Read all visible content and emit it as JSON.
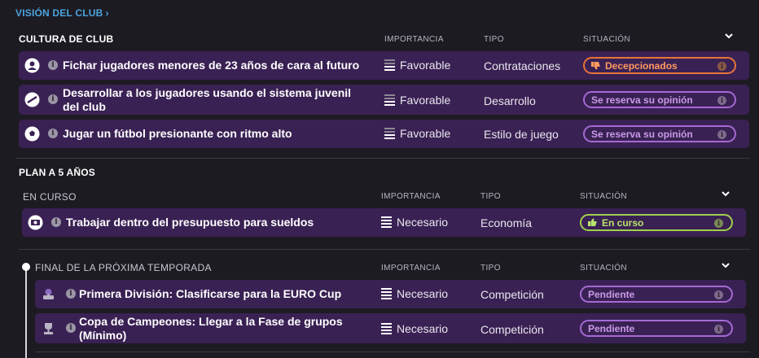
{
  "header": {
    "link_label": "VISIÓN DEL CLUB",
    "link_chevron": "›"
  },
  "columns": {
    "importance": "IMPORTANCIA",
    "type": "TIPO",
    "status": "SITUACIÓN"
  },
  "collapse_icon": "chevron-down-icon",
  "culture": {
    "title": "CULTURA DE CLUB",
    "rows": [
      {
        "icon": "user-icon",
        "title": "Fichar jugadores menores de 23 años de cara al futuro",
        "importance": "Favorable",
        "type": "Contrataciones",
        "status": "Decepcionados",
        "status_color": "#e8743a",
        "status_icon": "thumbs-down-icon"
      },
      {
        "icon": "youth-icon",
        "title_line1": "Desarrollar a los jugadores usando el sistema juvenil",
        "title_line2": "del club",
        "importance": "Favorable",
        "type": "Desarrollo",
        "status": "Se reserva su opinión",
        "status_color": "#a46ad3"
      },
      {
        "icon": "ball-icon",
        "title": "Jugar un fútbol presionante con ritmo alto",
        "importance": "Favorable",
        "type": "Estilo de juego",
        "status": "Se reserva su opinión",
        "status_color": "#a46ad3"
      }
    ]
  },
  "plan": {
    "title": "PLAN A 5 AÑOS",
    "ongoing": {
      "title": "EN CURSO",
      "rows": [
        {
          "icon": "money-icon",
          "title": "Trabajar dentro del presupuesto para sueldos",
          "importance": "Necesario",
          "type": "Economía",
          "status": "En curso",
          "status_color": "#9fd14a",
          "status_icon": "thumbs-up-icon"
        }
      ]
    },
    "end_season": {
      "title": "FINAL DE LA PRÓXIMA TEMPORADA",
      "rows": [
        {
          "icon": "league-icon",
          "title": "Primera División: Clasificarse para la EURO Cup",
          "importance": "Necesario",
          "type": "Competición",
          "status": "Pendiente",
          "status_color": "#a46ad3"
        },
        {
          "icon": "cup-icon",
          "title_line1": "Copa de Campeones: Llegar a la Fase de grupos",
          "title_line2": "(Mínimo)",
          "importance": "Necesario",
          "type": "Competición",
          "status": "Pendiente",
          "status_color": "#a46ad3"
        }
      ]
    }
  },
  "info_glyph": "i"
}
